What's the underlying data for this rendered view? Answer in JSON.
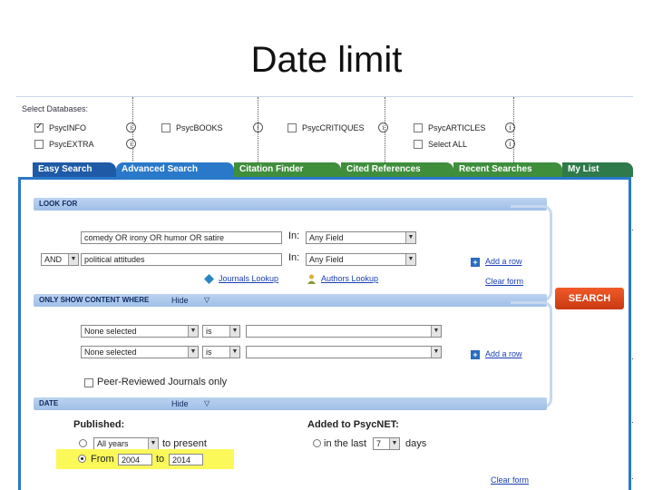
{
  "slide": {
    "title": "Date limit"
  },
  "databases": {
    "heading": "Select Databases:",
    "items": [
      {
        "label": "PsycINFO",
        "checked": true
      },
      {
        "label": "PsycBOOKS",
        "checked": false
      },
      {
        "label": "PsycCRITIQUES",
        "checked": false
      },
      {
        "label": "PsycARTICLES",
        "checked": false
      },
      {
        "label": "PsycEXTRA",
        "checked": false
      },
      {
        "label": "Select ALL",
        "checked": false
      }
    ]
  },
  "tabs": [
    {
      "label": "Easy Search",
      "color": "#1f5aa6"
    },
    {
      "label": "Advanced Search",
      "color": "#2a78c9"
    },
    {
      "label": "Citation Finder",
      "color": "#3f8e3c"
    },
    {
      "label": "Cited References",
      "color": "#3f8e3c"
    },
    {
      "label": "Recent Searches",
      "color": "#3f8e3c"
    },
    {
      "label": "My List",
      "color": "#2e7a4a"
    }
  ],
  "look_for": {
    "heading": "LOOK FOR",
    "rows": [
      {
        "operator": "",
        "query": "comedy OR irony OR humor OR satire",
        "in_label": "In:",
        "field": "Any Field"
      },
      {
        "operator": "AND",
        "query": "political attitudes",
        "in_label": "In:",
        "field": "Any Field"
      }
    ],
    "journals_lookup": "Journals Lookup",
    "authors_lookup": "Authors Lookup",
    "add_row": "Add a row",
    "clear_form": "Clear form"
  },
  "content_where": {
    "heading": "ONLY SHOW CONTENT WHERE",
    "hide": "Hide",
    "rows": [
      {
        "field": "None selected",
        "op": "is",
        "value": ""
      },
      {
        "field": "None selected",
        "op": "is",
        "value": ""
      }
    ],
    "add_row": "Add a row",
    "peer_reviewed": "Peer-Reviewed Journals only"
  },
  "search_button": "SEARCH",
  "date": {
    "heading": "DATE",
    "hide": "Hide",
    "published_label": "Published:",
    "all_years": "All years",
    "to_present": "to present",
    "from_label": "From",
    "from_year": "2004",
    "to_label": "to",
    "to_year": "2014",
    "added_label": "Added to PsycNET:",
    "in_the_last": "in the last",
    "last_value": "7",
    "days": "days",
    "clear_form": "Clear form"
  }
}
